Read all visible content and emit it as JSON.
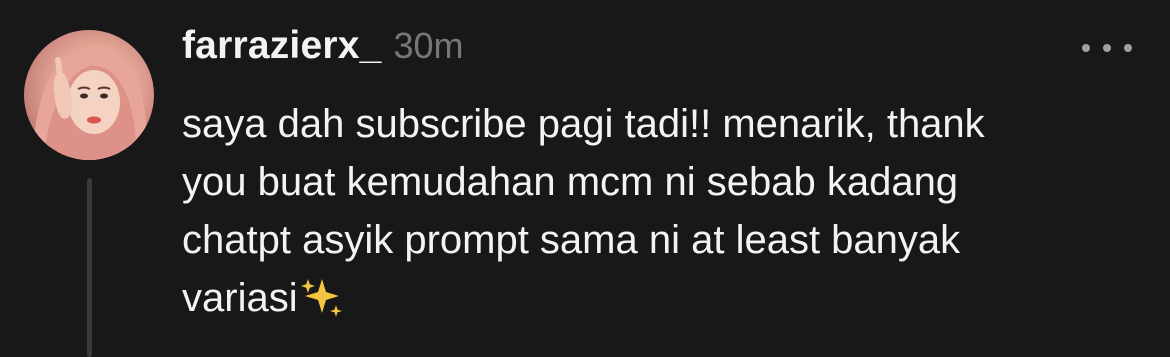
{
  "post": {
    "author": {
      "username": "farrazierx_",
      "avatar_icon": "profile-photo-avatar"
    },
    "timestamp": "30m",
    "more_icon": "more-horizontal-icon",
    "text_lines": [
      "saya dah subscribe pagi tadi!! menarik, thank",
      "you buat kemudahan mcm ni sebab kadang",
      "chatpt asyik prompt sama ni at least banyak",
      "variasi"
    ],
    "emoji": "sparkles-emoji"
  },
  "colors": {
    "background": "#181818",
    "text_primary": "#f3f3f3",
    "text_secondary": "#777777",
    "thread_line": "#3a3a3a",
    "sparkles": "#f5c542"
  }
}
